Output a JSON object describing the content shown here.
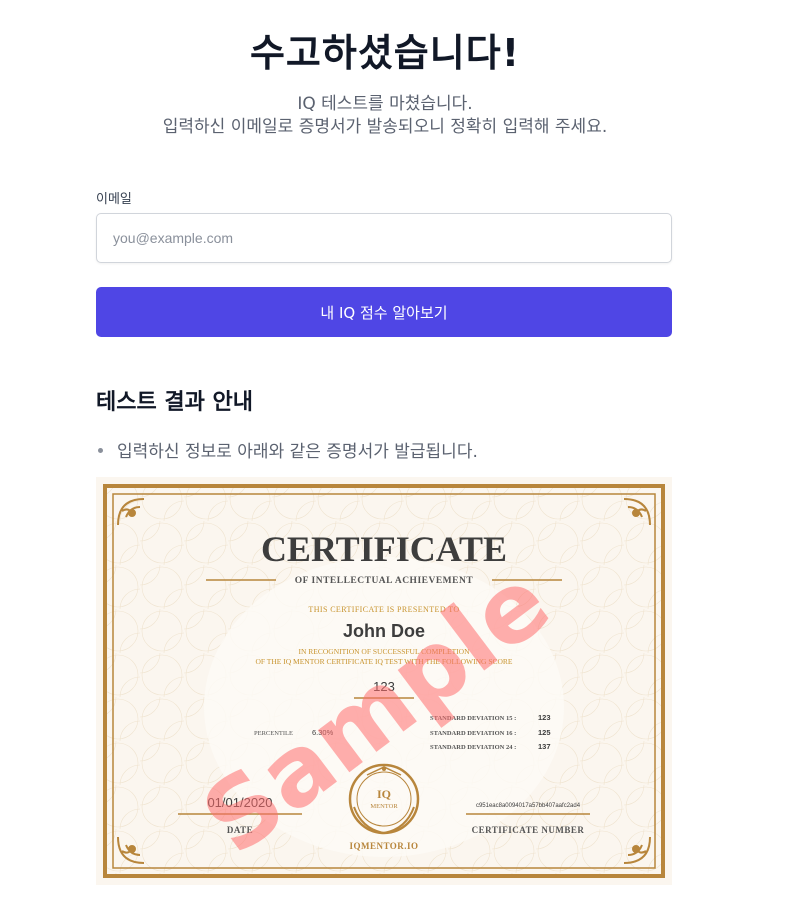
{
  "header": {
    "title": "수고하셨습니다!",
    "subtitle_line1": "IQ 테스트를 마쳤습니다.",
    "subtitle_line2": "입력하신 이메일로 증명서가 발송되오니 정확히 입력해 주세요."
  },
  "form": {
    "email_label": "이메일",
    "email_placeholder": "you@example.com",
    "email_value": "",
    "submit_label": "내 IQ 점수 알아보기"
  },
  "results_info": {
    "heading": "테스트 결과 안내",
    "items": [
      "입력하신 정보로 아래와 같은 증명서가 발급됩니다."
    ]
  },
  "certificate": {
    "title": "CERTIFICATE",
    "subtitle": "OF INTELLECTUAL ACHIEVEMENT",
    "presented_to": "THIS CERTIFICATE IS PRESENTED TO",
    "recipient_name": "John Doe",
    "recognition_line1": "IN RECOGNITION OF SUCCESSFUL COMPLETION",
    "recognition_line2": "OF THE IQ MENTOR CERTIFICATE IQ TEST WITH THE FOLLOWING SCORE",
    "score": "123",
    "percentile_label": "PERCENTILE",
    "percentile_value": "6.30%",
    "sd15_label": "STANDARD DEVIATION 15 :",
    "sd15_value": "123",
    "sd16_label": "STANDARD DEVIATION 16 :",
    "sd16_value": "125",
    "sd24_label": "STANDARD DEVIATION 24 :",
    "sd24_value": "137",
    "date_value": "01/01/2020",
    "date_label": "DATE",
    "seal_line1": "IQ",
    "seal_line2": "MENTOR",
    "site": "IQMENTOR.IO",
    "certificate_number_value": "c951eac8a0094017a57bb407aafc2ad4",
    "certificate_number_label": "CERTIFICATE NUMBER",
    "watermark": "Sample"
  },
  "colors": {
    "accent": "#4f46e5",
    "gold": "#b8863c",
    "gold_text": "#c8942f",
    "watermark": "#ff6e6e"
  }
}
